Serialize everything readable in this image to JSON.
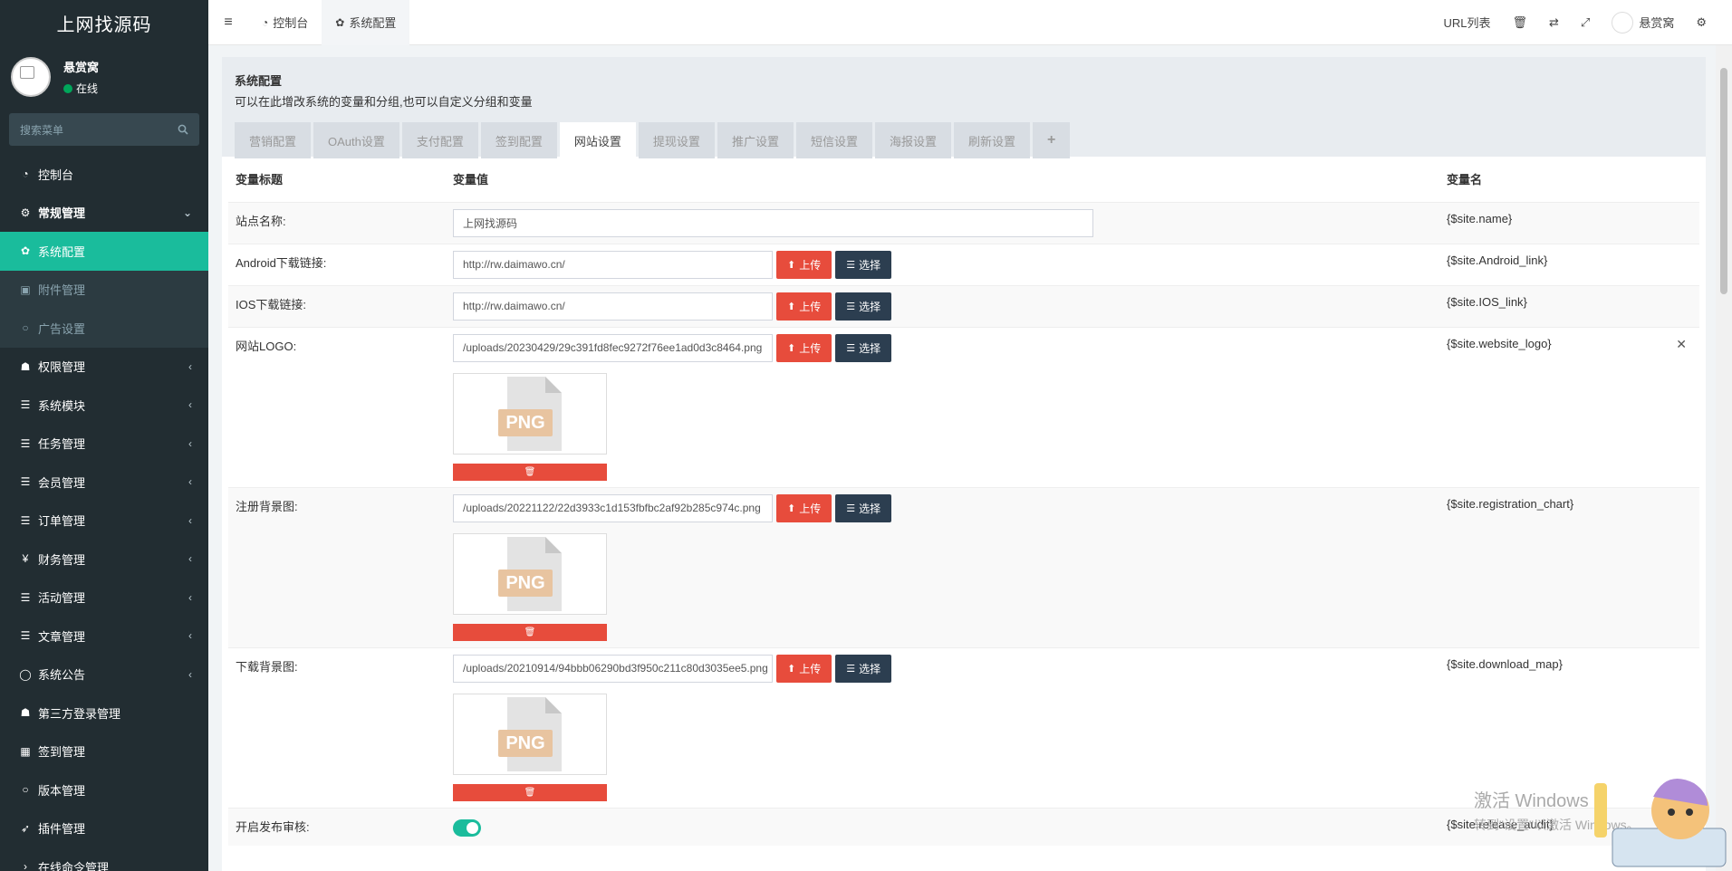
{
  "app": {
    "logo": "上网找源码"
  },
  "user": {
    "name": "悬赏窝",
    "status": "在线"
  },
  "search": {
    "placeholder": "搜索菜单"
  },
  "menu": [
    {
      "label": "控制台",
      "icon": "dashboard-icon",
      "caret": ""
    },
    {
      "label": "常规管理",
      "icon": "cogs-icon",
      "caret": "⌄"
    },
    {
      "label": "系统配置",
      "icon": "gear-icon",
      "caret": ""
    },
    {
      "label": "附件管理",
      "icon": "image-icon",
      "caret": ""
    },
    {
      "label": "广告设置",
      "icon": "circle-icon",
      "caret": ""
    },
    {
      "label": "权限管理",
      "icon": "group-icon",
      "caret": "‹"
    },
    {
      "label": "系统模块",
      "icon": "list-icon",
      "caret": "‹"
    },
    {
      "label": "任务管理",
      "icon": "list-icon",
      "caret": "‹"
    },
    {
      "label": "会员管理",
      "icon": "list-icon",
      "caret": "‹"
    },
    {
      "label": "订单管理",
      "icon": "list-icon",
      "caret": "‹"
    },
    {
      "label": "财务管理",
      "icon": "yen-icon",
      "caret": "‹"
    },
    {
      "label": "活动管理",
      "icon": "list-icon",
      "caret": "‹"
    },
    {
      "label": "文章管理",
      "icon": "list-icon",
      "caret": "‹"
    },
    {
      "label": "系统公告",
      "icon": "comment-icon",
      "caret": "‹"
    },
    {
      "label": "第三方登录管理",
      "icon": "group-icon",
      "caret": ""
    },
    {
      "label": "签到管理",
      "icon": "calendar-icon",
      "caret": ""
    },
    {
      "label": "版本管理",
      "icon": "circle-icon",
      "caret": ""
    },
    {
      "label": "插件管理",
      "icon": "rocket-icon",
      "caret": ""
    },
    {
      "label": "在线命令管理",
      "icon": "terminal-icon",
      "caret": ""
    }
  ],
  "header": {
    "tabs": [
      {
        "label": "控制台",
        "icon": "dashboard-icon"
      },
      {
        "label": "系统配置",
        "icon": "gear-icon"
      }
    ],
    "url_list": "URL列表",
    "user_name": "悬赏窝"
  },
  "panel": {
    "title": "系统配置",
    "subtitle": "可以在此增改系统的变量和分组,也可以自定义分组和变量",
    "tabs": [
      "营销配置",
      "OAuth设置",
      "支付配置",
      "签到配置",
      "网站设置",
      "提现设置",
      "推广设置",
      "短信设置",
      "海报设置",
      "刷新设置",
      "+"
    ],
    "active_tab": "网站设置"
  },
  "table": {
    "headers": {
      "title": "变量标题",
      "value": "变量值",
      "name": "变量名"
    },
    "upload_label": "上传",
    "select_label": "选择",
    "thumb_label": "PNG",
    "rows": [
      {
        "title": "站点名称:",
        "value": "上网找源码",
        "var": "{$site.name}"
      },
      {
        "title": "Android下载链接:",
        "value": "http://rw.daimawo.cn/",
        "var": "{$site.Android_link}"
      },
      {
        "title": "IOS下载链接:",
        "value": "http://rw.daimawo.cn/",
        "var": "{$site.IOS_link}"
      },
      {
        "title": "网站LOGO:",
        "value": "/uploads/20230429/29c391fd8fec9272f76ee1ad0d3c8464.png",
        "var": "{$site.website_logo}"
      },
      {
        "title": "注册背景图:",
        "value": "/uploads/20221122/22d3933c1d153fbfbc2af92b285c974c.png",
        "var": "{$site.registration_chart}"
      },
      {
        "title": "下载背景图:",
        "value": "/uploads/20210914/94bbb06290bd3f950c211c80d3035ee5.png",
        "var": "{$site.download_map}"
      },
      {
        "title": "开启发布审核:",
        "value": "",
        "var": "{$site.release_audit}"
      }
    ]
  },
  "watermark": {
    "line1": "激活 Windows",
    "line2": "转到\"设置\"以激活 Windows。"
  },
  "colors": {
    "sidebar": "#222d32",
    "active": "#1abc9c",
    "danger": "#e74c3c",
    "dark": "#2c3e50"
  }
}
